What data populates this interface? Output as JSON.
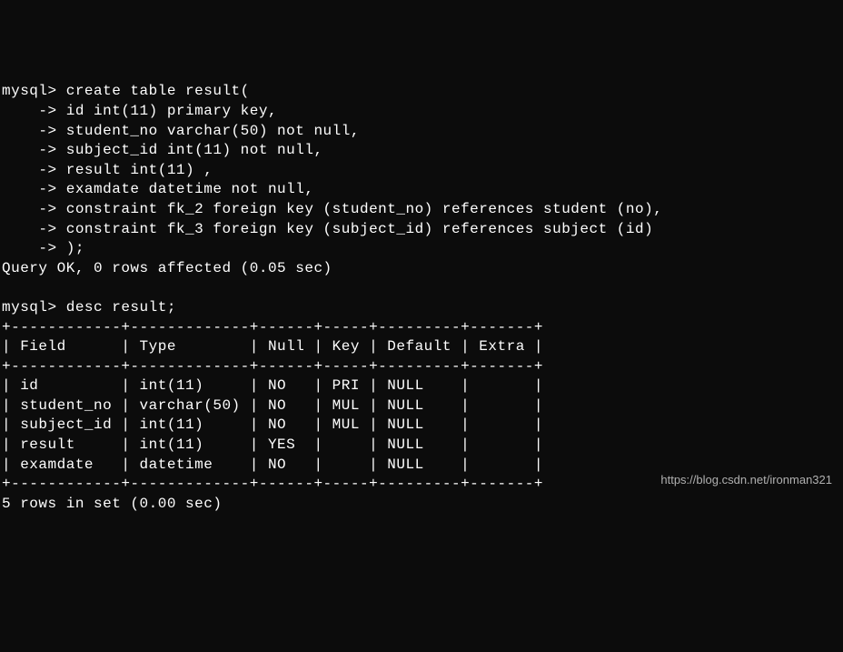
{
  "prompt": "mysql>",
  "cont": "    ->",
  "create_stmt": {
    "l0": " create table result(",
    "l1": " id int(11) primary key,",
    "l2": " student_no varchar(50) not null,",
    "l3": " subject_id int(11) not null,",
    "l4": " result int(11) ,",
    "l5": " examdate datetime not null,",
    "l6": " constraint fk_2 foreign key (student_no) references student (no),",
    "l7": " constraint fk_3 foreign key (subject_id) references subject (id)",
    "l8": " );"
  },
  "create_result": "Query OK, 0 rows affected (0.05 sec)",
  "desc_stmt": " desc result;",
  "table": {
    "border": "+------------+-------------+------+-----+---------+-------+",
    "header": "| Field      | Type        | Null | Key | Default | Extra |",
    "rows": [
      "| id         | int(11)     | NO   | PRI | NULL    |       |",
      "| student_no | varchar(50) | NO   | MUL | NULL    |       |",
      "| subject_id | int(11)     | NO   | MUL | NULL    |       |",
      "| result     | int(11)     | YES  |     | NULL    |       |",
      "| examdate   | datetime    | NO   |     | NULL    |       |"
    ]
  },
  "desc_result": "5 rows in set (0.00 sec)",
  "watermark": "https://blog.csdn.net/ironman321",
  "chart_data": {
    "type": "table",
    "title": "desc result",
    "columns": [
      "Field",
      "Type",
      "Null",
      "Key",
      "Default",
      "Extra"
    ],
    "rows": [
      [
        "id",
        "int(11)",
        "NO",
        "PRI",
        "NULL",
        ""
      ],
      [
        "student_no",
        "varchar(50)",
        "NO",
        "MUL",
        "NULL",
        ""
      ],
      [
        "subject_id",
        "int(11)",
        "NO",
        "MUL",
        "NULL",
        ""
      ],
      [
        "result",
        "int(11)",
        "YES",
        "",
        "NULL",
        ""
      ],
      [
        "examdate",
        "datetime",
        "NO",
        "",
        "NULL",
        ""
      ]
    ]
  }
}
